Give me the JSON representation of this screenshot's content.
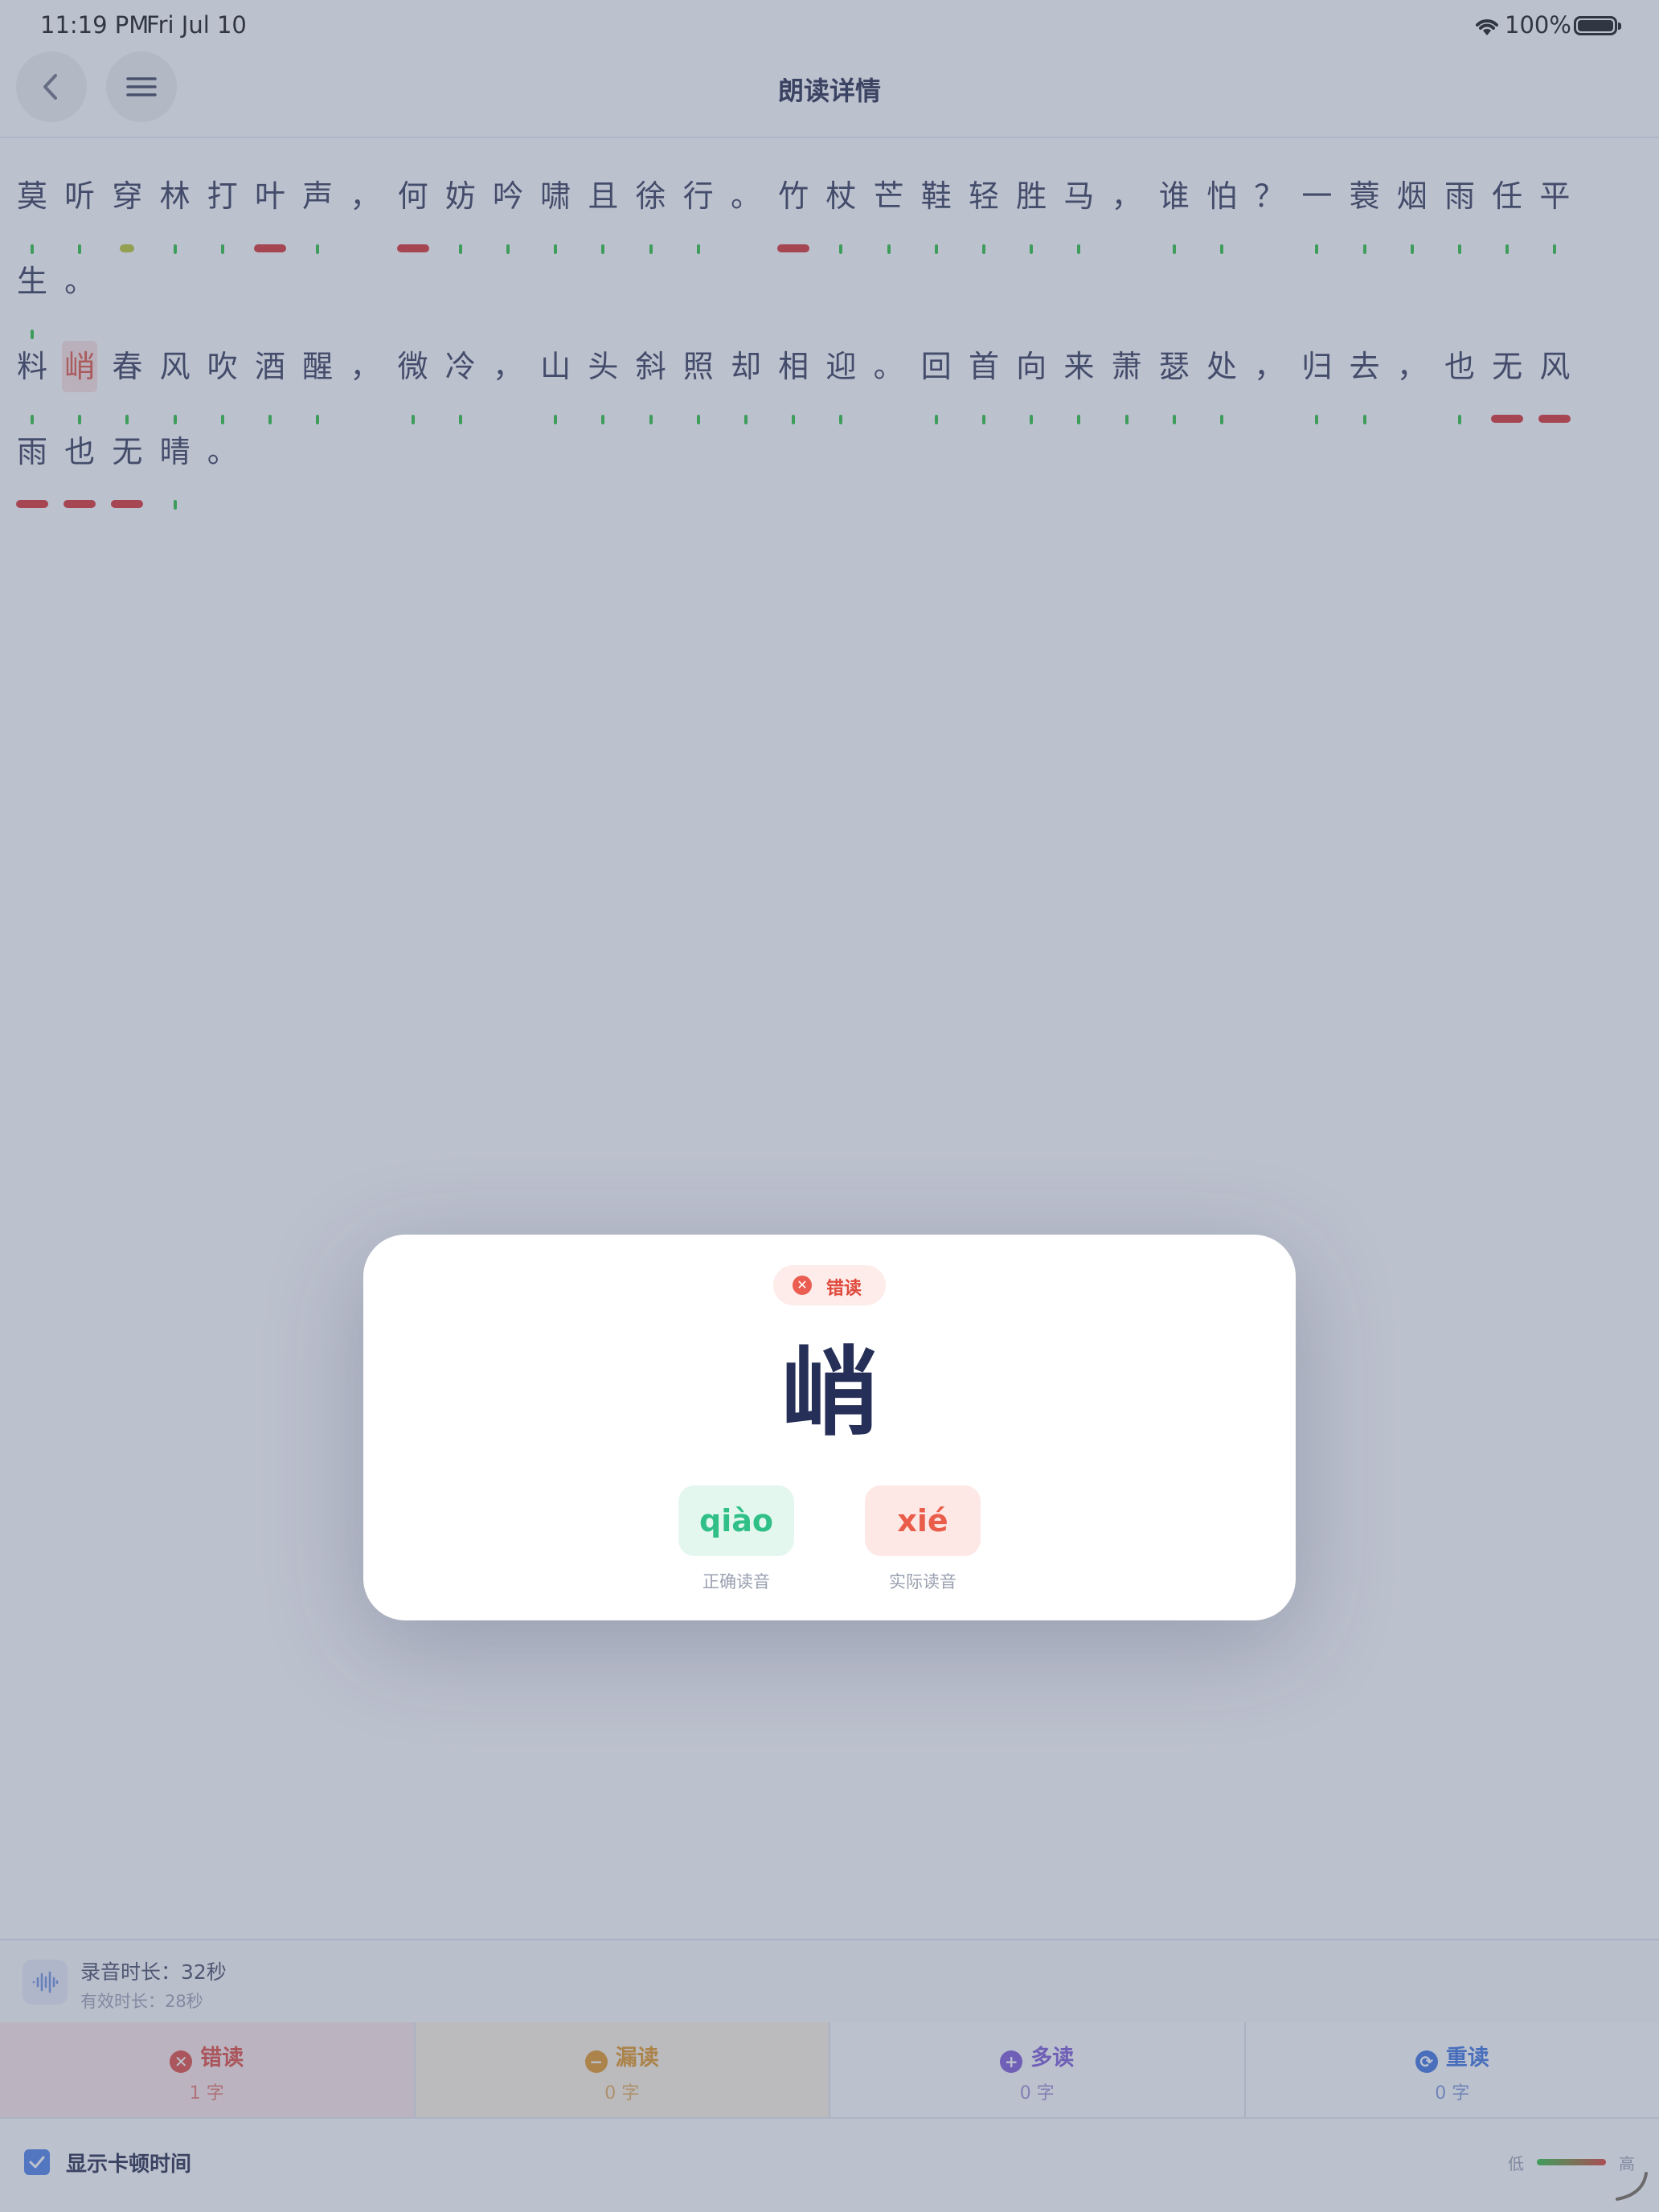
{
  "status_bar": {
    "time": "11:19 PM",
    "date": "Fri Jul 10",
    "battery": "100%"
  },
  "nav": {
    "title": "朗读详情"
  },
  "poem": {
    "lines": [
      [
        {
          "c": "莫",
          "m": "tick"
        },
        {
          "c": "听",
          "m": "tick"
        },
        {
          "c": "穿",
          "m": "yellow"
        },
        {
          "c": "林",
          "m": "tick"
        },
        {
          "c": "打",
          "m": "tick"
        },
        {
          "c": "叶",
          "m": "dash"
        },
        {
          "c": "声",
          "m": "tick"
        },
        {
          "c": "，",
          "m": ""
        },
        {
          "c": "何",
          "m": "dash"
        },
        {
          "c": "妨",
          "m": "tick"
        },
        {
          "c": "吟",
          "m": "tick"
        },
        {
          "c": "啸",
          "m": "tick"
        },
        {
          "c": "且",
          "m": "tick"
        },
        {
          "c": "徐",
          "m": "tick"
        },
        {
          "c": "行",
          "m": "tick"
        },
        {
          "c": "。",
          "m": ""
        },
        {
          "c": "竹",
          "m": "dash"
        },
        {
          "c": "杖",
          "m": "tick"
        },
        {
          "c": "芒",
          "m": "tick"
        },
        {
          "c": "鞋",
          "m": "tick"
        },
        {
          "c": "轻",
          "m": "tick"
        },
        {
          "c": "胜",
          "m": "tick"
        },
        {
          "c": "马",
          "m": "tick"
        },
        {
          "c": "，",
          "m": ""
        },
        {
          "c": "谁",
          "m": "tick"
        },
        {
          "c": "怕",
          "m": "tick"
        },
        {
          "c": "？",
          "m": ""
        },
        {
          "c": "一",
          "m": "tick"
        },
        {
          "c": "蓑",
          "m": "tick"
        },
        {
          "c": "烟",
          "m": "tick"
        },
        {
          "c": "雨",
          "m": "tick"
        },
        {
          "c": "任",
          "m": "tick"
        },
        {
          "c": "平",
          "m": "tick"
        }
      ],
      [
        {
          "c": "生",
          "m": "tick"
        },
        {
          "c": "。",
          "m": ""
        }
      ],
      [
        {
          "c": "料",
          "m": "tick"
        },
        {
          "c": "峭",
          "m": "tick",
          "hl": true
        },
        {
          "c": "春",
          "m": "tick"
        },
        {
          "c": "风",
          "m": "tick"
        },
        {
          "c": "吹",
          "m": "tick"
        },
        {
          "c": "酒",
          "m": "tick"
        },
        {
          "c": "醒",
          "m": "tick"
        },
        {
          "c": "，",
          "m": ""
        },
        {
          "c": "微",
          "m": "tick"
        },
        {
          "c": "冷",
          "m": "tick"
        },
        {
          "c": "，",
          "m": ""
        },
        {
          "c": "山",
          "m": "tick"
        },
        {
          "c": "头",
          "m": "tick"
        },
        {
          "c": "斜",
          "m": "tick"
        },
        {
          "c": "照",
          "m": "tick"
        },
        {
          "c": "却",
          "m": "tick"
        },
        {
          "c": "相",
          "m": "tick"
        },
        {
          "c": "迎",
          "m": "tick"
        },
        {
          "c": "。",
          "m": ""
        },
        {
          "c": "回",
          "m": "tick"
        },
        {
          "c": "首",
          "m": "tick"
        },
        {
          "c": "向",
          "m": "tick"
        },
        {
          "c": "来",
          "m": "tick"
        },
        {
          "c": "萧",
          "m": "tick"
        },
        {
          "c": "瑟",
          "m": "tick"
        },
        {
          "c": "处",
          "m": "tick"
        },
        {
          "c": "，",
          "m": ""
        },
        {
          "c": "归",
          "m": "tick"
        },
        {
          "c": "去",
          "m": "tick"
        },
        {
          "c": "，",
          "m": ""
        },
        {
          "c": "也",
          "m": "tick"
        },
        {
          "c": "无",
          "m": "dash"
        },
        {
          "c": "风",
          "m": "dash"
        }
      ],
      [
        {
          "c": "雨",
          "m": "dash"
        },
        {
          "c": "也",
          "m": "dash"
        },
        {
          "c": "无",
          "m": "dash"
        },
        {
          "c": "晴",
          "m": "tick"
        },
        {
          "c": "。",
          "m": ""
        }
      ]
    ]
  },
  "modal": {
    "badge": "错读",
    "character": "峭",
    "correct_pinyin": "qiào",
    "correct_caption": "正确读音",
    "actual_pinyin": "xié",
    "actual_caption": "实际读音"
  },
  "recording": {
    "duration": "录音时长：32秒",
    "effective": "有效时长：28秒"
  },
  "tabs": [
    {
      "label": "错读",
      "count": "1 字",
      "icon": "x-circle-icon",
      "color": "#e0483b"
    },
    {
      "label": "漏读",
      "count": "0 字",
      "icon": "minus-circle-icon",
      "color": "#e2951e"
    },
    {
      "label": "多读",
      "count": "0 字",
      "icon": "plus-circle-icon",
      "color": "#7b57d6"
    },
    {
      "label": "重读",
      "count": "0 字",
      "icon": "repeat-circle-icon",
      "color": "#3a73e0"
    }
  ],
  "footer": {
    "show_pause_label": "显示卡顿时间",
    "checked": true,
    "legend_low": "低",
    "legend_high": "高"
  },
  "colors": {
    "correct": "#27c23a",
    "error": "#d92b2b",
    "hesitation": "#b8c72a",
    "accent": "#4a7fe8"
  }
}
